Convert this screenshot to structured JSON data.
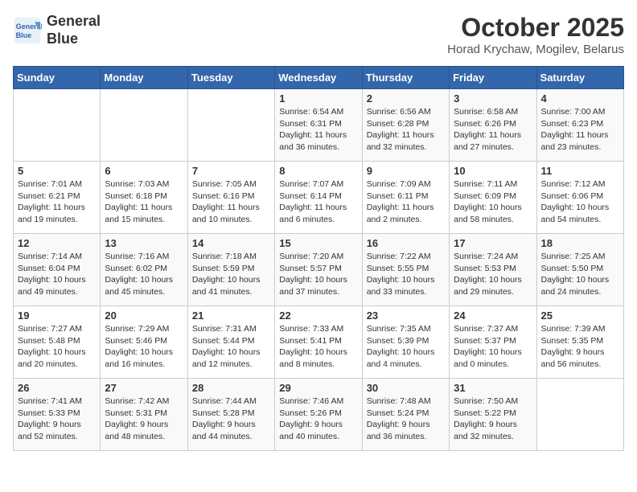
{
  "header": {
    "logo_line1": "General",
    "logo_line2": "Blue",
    "month": "October 2025",
    "location": "Horad Krychaw, Mogilev, Belarus"
  },
  "weekdays": [
    "Sunday",
    "Monday",
    "Tuesday",
    "Wednesday",
    "Thursday",
    "Friday",
    "Saturday"
  ],
  "weeks": [
    [
      {
        "day": "",
        "content": ""
      },
      {
        "day": "",
        "content": ""
      },
      {
        "day": "",
        "content": ""
      },
      {
        "day": "1",
        "content": "Sunrise: 6:54 AM\nSunset: 6:31 PM\nDaylight: 11 hours\nand 36 minutes."
      },
      {
        "day": "2",
        "content": "Sunrise: 6:56 AM\nSunset: 6:28 PM\nDaylight: 11 hours\nand 32 minutes."
      },
      {
        "day": "3",
        "content": "Sunrise: 6:58 AM\nSunset: 6:26 PM\nDaylight: 11 hours\nand 27 minutes."
      },
      {
        "day": "4",
        "content": "Sunrise: 7:00 AM\nSunset: 6:23 PM\nDaylight: 11 hours\nand 23 minutes."
      }
    ],
    [
      {
        "day": "5",
        "content": "Sunrise: 7:01 AM\nSunset: 6:21 PM\nDaylight: 11 hours\nand 19 minutes."
      },
      {
        "day": "6",
        "content": "Sunrise: 7:03 AM\nSunset: 6:18 PM\nDaylight: 11 hours\nand 15 minutes."
      },
      {
        "day": "7",
        "content": "Sunrise: 7:05 AM\nSunset: 6:16 PM\nDaylight: 11 hours\nand 10 minutes."
      },
      {
        "day": "8",
        "content": "Sunrise: 7:07 AM\nSunset: 6:14 PM\nDaylight: 11 hours\nand 6 minutes."
      },
      {
        "day": "9",
        "content": "Sunrise: 7:09 AM\nSunset: 6:11 PM\nDaylight: 11 hours\nand 2 minutes."
      },
      {
        "day": "10",
        "content": "Sunrise: 7:11 AM\nSunset: 6:09 PM\nDaylight: 10 hours\nand 58 minutes."
      },
      {
        "day": "11",
        "content": "Sunrise: 7:12 AM\nSunset: 6:06 PM\nDaylight: 10 hours\nand 54 minutes."
      }
    ],
    [
      {
        "day": "12",
        "content": "Sunrise: 7:14 AM\nSunset: 6:04 PM\nDaylight: 10 hours\nand 49 minutes."
      },
      {
        "day": "13",
        "content": "Sunrise: 7:16 AM\nSunset: 6:02 PM\nDaylight: 10 hours\nand 45 minutes."
      },
      {
        "day": "14",
        "content": "Sunrise: 7:18 AM\nSunset: 5:59 PM\nDaylight: 10 hours\nand 41 minutes."
      },
      {
        "day": "15",
        "content": "Sunrise: 7:20 AM\nSunset: 5:57 PM\nDaylight: 10 hours\nand 37 minutes."
      },
      {
        "day": "16",
        "content": "Sunrise: 7:22 AM\nSunset: 5:55 PM\nDaylight: 10 hours\nand 33 minutes."
      },
      {
        "day": "17",
        "content": "Sunrise: 7:24 AM\nSunset: 5:53 PM\nDaylight: 10 hours\nand 29 minutes."
      },
      {
        "day": "18",
        "content": "Sunrise: 7:25 AM\nSunset: 5:50 PM\nDaylight: 10 hours\nand 24 minutes."
      }
    ],
    [
      {
        "day": "19",
        "content": "Sunrise: 7:27 AM\nSunset: 5:48 PM\nDaylight: 10 hours\nand 20 minutes."
      },
      {
        "day": "20",
        "content": "Sunrise: 7:29 AM\nSunset: 5:46 PM\nDaylight: 10 hours\nand 16 minutes."
      },
      {
        "day": "21",
        "content": "Sunrise: 7:31 AM\nSunset: 5:44 PM\nDaylight: 10 hours\nand 12 minutes."
      },
      {
        "day": "22",
        "content": "Sunrise: 7:33 AM\nSunset: 5:41 PM\nDaylight: 10 hours\nand 8 minutes."
      },
      {
        "day": "23",
        "content": "Sunrise: 7:35 AM\nSunset: 5:39 PM\nDaylight: 10 hours\nand 4 minutes."
      },
      {
        "day": "24",
        "content": "Sunrise: 7:37 AM\nSunset: 5:37 PM\nDaylight: 10 hours\nand 0 minutes."
      },
      {
        "day": "25",
        "content": "Sunrise: 7:39 AM\nSunset: 5:35 PM\nDaylight: 9 hours\nand 56 minutes."
      }
    ],
    [
      {
        "day": "26",
        "content": "Sunrise: 7:41 AM\nSunset: 5:33 PM\nDaylight: 9 hours\nand 52 minutes."
      },
      {
        "day": "27",
        "content": "Sunrise: 7:42 AM\nSunset: 5:31 PM\nDaylight: 9 hours\nand 48 minutes."
      },
      {
        "day": "28",
        "content": "Sunrise: 7:44 AM\nSunset: 5:28 PM\nDaylight: 9 hours\nand 44 minutes."
      },
      {
        "day": "29",
        "content": "Sunrise: 7:46 AM\nSunset: 5:26 PM\nDaylight: 9 hours\nand 40 minutes."
      },
      {
        "day": "30",
        "content": "Sunrise: 7:48 AM\nSunset: 5:24 PM\nDaylight: 9 hours\nand 36 minutes."
      },
      {
        "day": "31",
        "content": "Sunrise: 7:50 AM\nSunset: 5:22 PM\nDaylight: 9 hours\nand 32 minutes."
      },
      {
        "day": "",
        "content": ""
      }
    ]
  ]
}
